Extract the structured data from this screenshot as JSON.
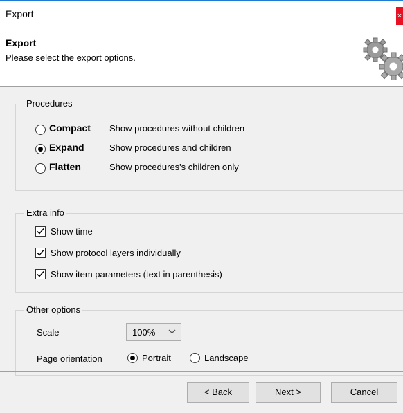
{
  "window": {
    "title": "Export",
    "close_glyph": "×"
  },
  "header": {
    "title": "Export",
    "subtitle": "Please select the export options.",
    "icon": "gears-icon"
  },
  "procedures": {
    "legend": "Procedures",
    "options": [
      {
        "name": "Compact",
        "desc": "Show procedures without children",
        "selected": false
      },
      {
        "name": "Expand",
        "desc": "Show procedures and children",
        "selected": true
      },
      {
        "name": "Flatten",
        "desc": "Show procedures's children only",
        "selected": false
      }
    ]
  },
  "extra_info": {
    "legend": "Extra info",
    "items": [
      {
        "label": "Show time",
        "checked": true
      },
      {
        "label": "Show protocol layers individually",
        "checked": true
      },
      {
        "label": "Show item parameters (text in parenthesis)",
        "checked": true
      }
    ]
  },
  "other_options": {
    "legend": "Other options",
    "scale_label": "Scale",
    "scale_value": "100%",
    "orientation_label": "Page orientation",
    "portrait": "Portrait",
    "landscape": "Landscape",
    "orientation_selected": "Portrait"
  },
  "buttons": {
    "back": "< Back",
    "next": "Next >",
    "cancel": "Cancel"
  },
  "colors": {
    "close": "#e81123",
    "title_border": "#1e7bd3",
    "dialog_bg": "#f0f0f0"
  }
}
